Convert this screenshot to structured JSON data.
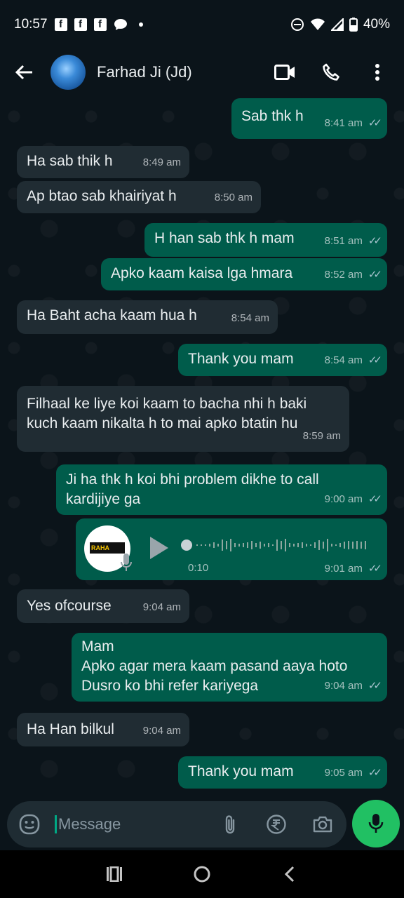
{
  "status_bar": {
    "time": "10:57",
    "battery": "40%",
    "icons": [
      "facebook-icon",
      "facebook-icon",
      "facebook-icon",
      "chat-icon",
      "dot-icon",
      "dnd-icon",
      "wifi-icon",
      "signal-icon",
      "battery-icon"
    ]
  },
  "header": {
    "contact_name": "Farhad Ji (Jd)",
    "icons": [
      "back-arrow-icon",
      "video-call-icon",
      "phone-icon",
      "more-vert-icon"
    ]
  },
  "messages": [
    {
      "dir": "out",
      "text": "Sab thk h",
      "time": "8:41 am",
      "read": true
    },
    {
      "dir": "in",
      "text": "Ha sab thik h",
      "time": "8:49 am"
    },
    {
      "dir": "in",
      "text": "Ap btao sab khairiyat h",
      "time": "8:50 am"
    },
    {
      "dir": "out",
      "text": "H han sab thk h mam",
      "time": "8:51 am",
      "read": true
    },
    {
      "dir": "out",
      "text": "Apko kaam kaisa lga hmara",
      "time": "8:52 am",
      "read": true
    },
    {
      "dir": "in",
      "text": "Ha Baht acha kaam hua h",
      "time": "8:54 am"
    },
    {
      "dir": "out",
      "text": "Thank you mam",
      "time": "8:54 am",
      "read": true
    },
    {
      "dir": "in",
      "text": "Filhaal ke liye koi kaam to bacha nhi h baki\nkuch kaam nikalta h to mai apko btatin hu",
      "time": "8:59 am"
    },
    {
      "dir": "out",
      "text": "Ji ha thk h koi bhi problem dikhe to call\nkardijiye ga",
      "time": "9:00 am",
      "read": true
    },
    {
      "dir": "in",
      "text": "Yes ofcourse",
      "time": "9:04 am"
    },
    {
      "dir": "out",
      "text": "Mam\nApko agar mera kaam pasand aaya hoto\nDusro ko bhi refer kariyega",
      "time": "9:04 am",
      "read": true
    },
    {
      "dir": "in",
      "text": "Ha Han bilkul",
      "time": "9:04 am"
    },
    {
      "dir": "out",
      "text": "Thank you mam",
      "time": "9:05 am",
      "read": true
    }
  ],
  "voice_message": {
    "duration": "0:10",
    "time": "9:01 am",
    "logo_text": "RAHA",
    "read": true
  },
  "composer": {
    "placeholder": "Message",
    "icons": [
      "emoji-icon",
      "attach-icon",
      "rupee-icon",
      "camera-icon",
      "mic-icon"
    ]
  },
  "colors": {
    "background": "#0b141a",
    "incoming_bubble": "#202c33",
    "outgoing_bubble": "#005c4b",
    "accent": "#21c063",
    "read_tick": "#a8c4cf"
  }
}
